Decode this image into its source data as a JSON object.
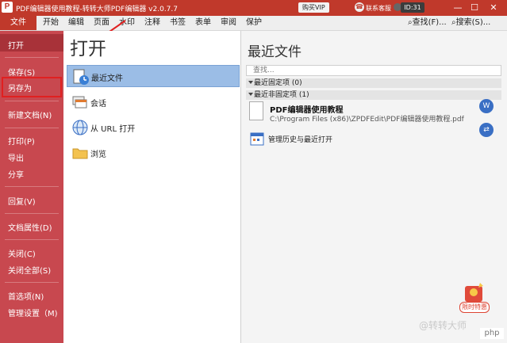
{
  "titlebar": {
    "app_icon": "P",
    "title": "PDF编辑器使用教程-转转大师PDF编辑器 v2.0.7.7",
    "vip_button": "购买VIP",
    "service": "联系客服",
    "user_id": "ID:31",
    "minimize": "—",
    "maximize": "☐",
    "close": "✕"
  },
  "menubar": {
    "file": "文件",
    "items": [
      "开始",
      "编辑",
      "页面",
      "水印",
      "注释",
      "书签",
      "表单",
      "审阅",
      "保护"
    ],
    "find": "查找(F)...",
    "search": "搜索(S)..."
  },
  "sidebar": {
    "open": "打开",
    "save": "保存(S)",
    "save_as": "另存为",
    "new_doc": "新建文档(N)",
    "print": "打印(P)",
    "export": "导出",
    "share": "分享",
    "revert": "回复(V)",
    "doc_props": "文档属性(D)",
    "close": "关闭(C)",
    "close_all": "关闭全部(S)",
    "preferences": "首选项(N)",
    "manage_settings": "管理设置（M)"
  },
  "open_panel": {
    "title": "打开",
    "items": [
      "最近文件",
      "会话",
      "从 URL 打开",
      "浏览"
    ]
  },
  "recent": {
    "title": "最近文件",
    "search_placeholder": "查找...",
    "pinned_group": "最近固定项 (0)",
    "unpinned_group": "最近非固定项 (1)",
    "file_name": "PDF编辑器使用教程",
    "file_path": "C:\\Program Files (x86)\\ZPDFEdit\\PDF编辑器使用教程.pdf",
    "manage_history": "管理历史与最近打开"
  },
  "promo": {
    "badge": "限时特惠"
  },
  "watermark": "@转转大师",
  "site_logo": "php"
}
